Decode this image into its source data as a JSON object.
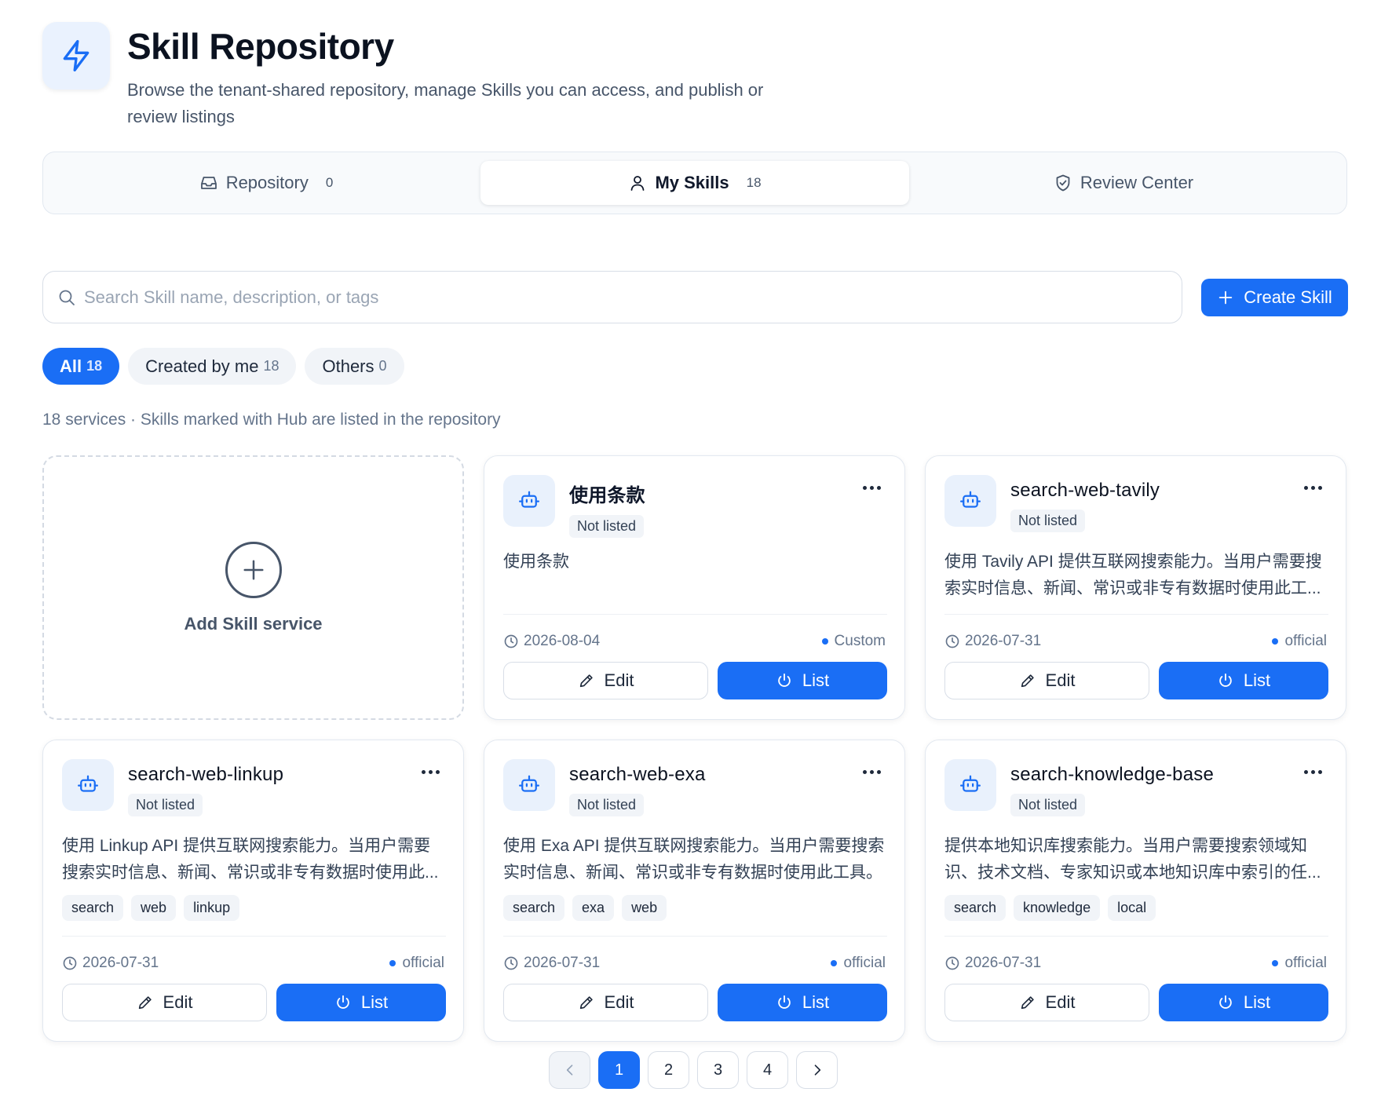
{
  "header": {
    "title": "Skill Repository",
    "subtitle": "Browse the tenant-shared repository, manage Skills you can access, and publish or review listings",
    "icon": "lightning-icon",
    "accent": "#1a6ef5"
  },
  "tabs": [
    {
      "label": "Repository",
      "count": "0",
      "icon": "inbox-icon",
      "active": false
    },
    {
      "label": "My Skills",
      "count": "18",
      "icon": "user-icon",
      "active": true
    },
    {
      "label": "Review Center",
      "count": "",
      "icon": "shield-check-icon",
      "active": false
    }
  ],
  "search": {
    "placeholder": "Search Skill name, description, or tags",
    "value": ""
  },
  "create_button": {
    "label": "Create Skill"
  },
  "filters": [
    {
      "label": "All",
      "count": "18",
      "active": true
    },
    {
      "label": "Created by me",
      "count": "18",
      "active": false
    },
    {
      "label": "Others",
      "count": "0",
      "active": false
    }
  ],
  "summary": "18 services · Skills marked with Hub are listed in the repository",
  "add_card": {
    "label": "Add Skill service"
  },
  "cards": [
    {
      "name": "使用条款",
      "status": "Not listed",
      "description": "使用条款",
      "tags": [],
      "date": "2026-08-04",
      "source": "Custom",
      "edit": "Edit",
      "list": "List"
    },
    {
      "name": "search-web-tavily",
      "status": "Not listed",
      "description": "使用 Tavily API 提供互联网搜索能力。当用户需要搜索实时信息、新闻、常识或非专有数据时使用此工...",
      "tags": [],
      "date": "2026-07-31",
      "source": "official",
      "edit": "Edit",
      "list": "List"
    },
    {
      "name": "search-web-linkup",
      "status": "Not listed",
      "description": "使用 Linkup API 提供互联网搜索能力。当用户需要搜索实时信息、新闻、常识或非专有数据时使用此...",
      "tags": [
        "search",
        "web",
        "linkup"
      ],
      "date": "2026-07-31",
      "source": "official",
      "edit": "Edit",
      "list": "List"
    },
    {
      "name": "search-web-exa",
      "status": "Not listed",
      "description": "使用 Exa API 提供互联网搜索能力。当用户需要搜索实时信息、新闻、常识或非专有数据时使用此工具。",
      "tags": [
        "search",
        "exa",
        "web"
      ],
      "date": "2026-07-31",
      "source": "official",
      "edit": "Edit",
      "list": "List"
    },
    {
      "name": "search-knowledge-base",
      "status": "Not listed",
      "description": "提供本地知识库搜索能力。当用户需要搜索领域知识、技术文档、专家知识或本地知识库中索引的任...",
      "tags": [
        "search",
        "knowledge",
        "local"
      ],
      "date": "2026-07-31",
      "source": "official",
      "edit": "Edit",
      "list": "List"
    }
  ],
  "pagination": {
    "pages": [
      "1",
      "2",
      "3",
      "4"
    ],
    "current": "1"
  }
}
